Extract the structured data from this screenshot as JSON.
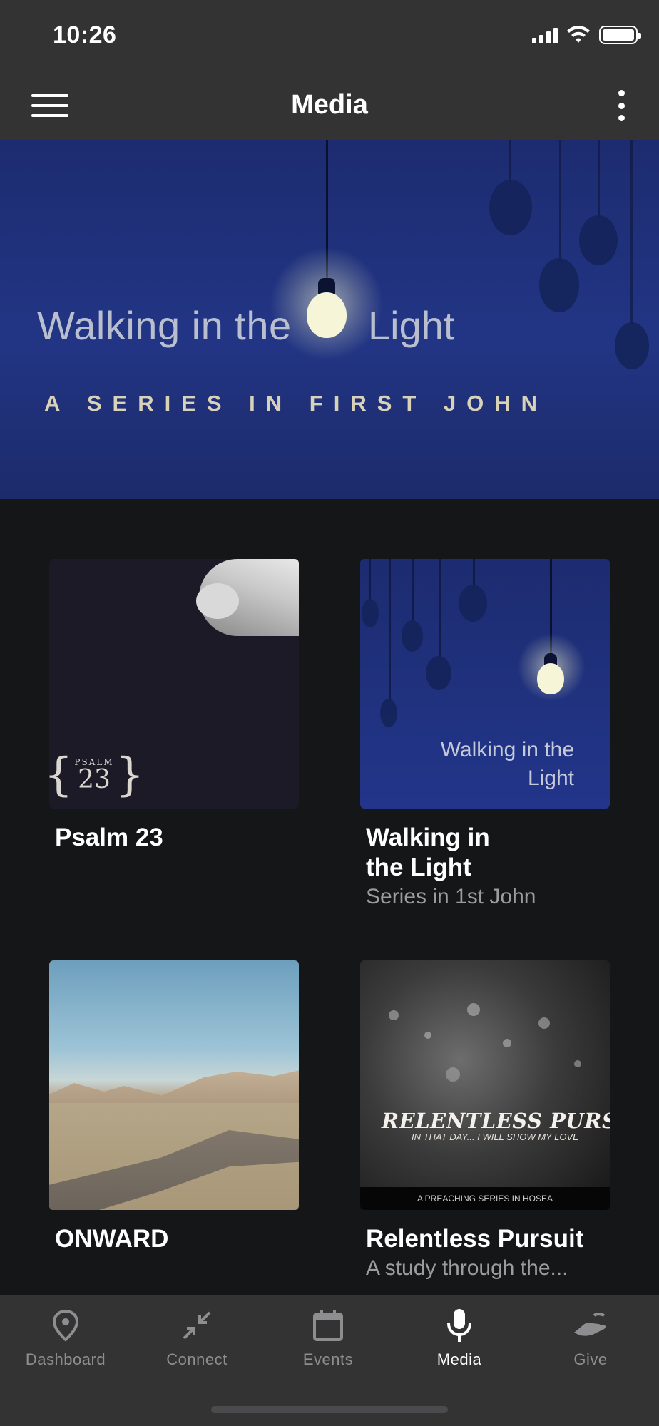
{
  "status_bar": {
    "time": "10:26"
  },
  "nav": {
    "title": "Media"
  },
  "hero": {
    "title_left": "Walking in the",
    "title_right": "Light",
    "subtitle": "A SERIES IN FIRST JOHN"
  },
  "cards": [
    {
      "title": "Psalm 23",
      "subtitle": "",
      "art_label_top": "PSALM",
      "art_label_num": "23"
    },
    {
      "title": "Walking in the Light",
      "title_line1": "Walking in",
      "title_line2": "the Light",
      "subtitle": "Series in 1st John",
      "art_text_1": "Walking in the",
      "art_text_2": "Light"
    },
    {
      "title": "ONWARD",
      "subtitle": ""
    },
    {
      "title": "Relentless Pursuit",
      "subtitle": "A study through the...",
      "art_title": "RELENTLESS PURSUIT",
      "art_sub": "IN THAT DAY... I WILL SHOW MY LOVE",
      "art_band": "A PREACHING SERIES IN HOSEA"
    }
  ],
  "tabs": [
    {
      "label": "Dashboard",
      "icon": "map-pin-icon",
      "active": false
    },
    {
      "label": "Connect",
      "icon": "collapse-arrows-icon",
      "active": false
    },
    {
      "label": "Events",
      "icon": "calendar-icon",
      "active": false
    },
    {
      "label": "Media",
      "icon": "microphone-icon",
      "active": true
    },
    {
      "label": "Give",
      "icon": "give-hand-icon",
      "active": false
    }
  ],
  "colors": {
    "bars": "#333334",
    "background": "#151618",
    "hero_blue": "#22358a",
    "inactive_tab": "#8e8e90"
  }
}
